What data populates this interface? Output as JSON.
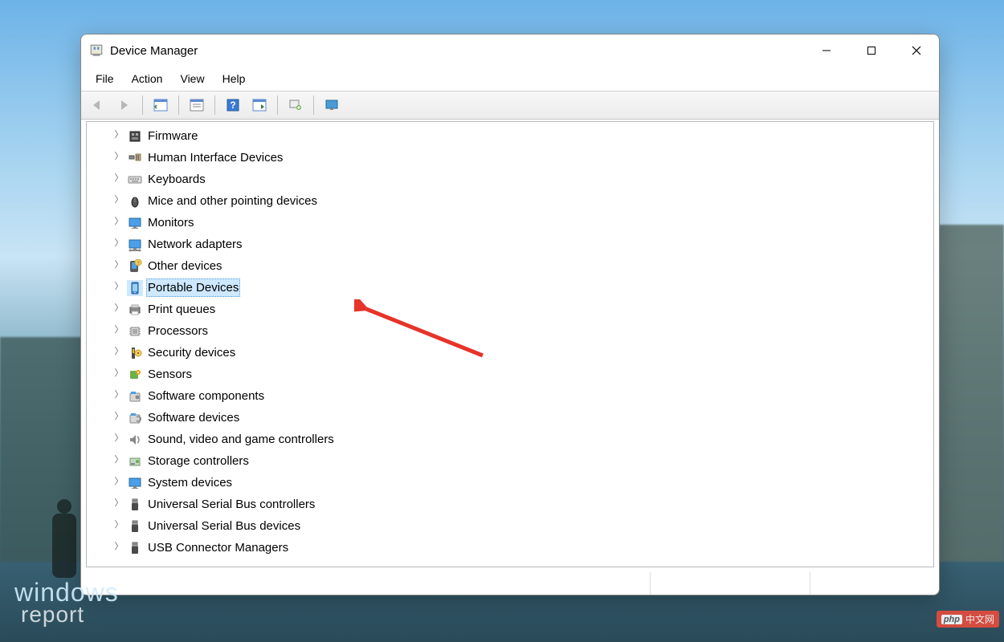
{
  "window": {
    "title": "Device Manager"
  },
  "menu": {
    "items": [
      {
        "label": "File"
      },
      {
        "label": "Action"
      },
      {
        "label": "View"
      },
      {
        "label": "Help"
      }
    ]
  },
  "toolbar": {
    "buttons": [
      {
        "name": "back",
        "enabled": false
      },
      {
        "name": "forward",
        "enabled": false
      },
      {
        "name": "show-hide-tree",
        "enabled": true
      },
      {
        "name": "properties",
        "enabled": true
      },
      {
        "name": "help",
        "enabled": true
      },
      {
        "name": "action-view",
        "enabled": true
      },
      {
        "name": "scan-hardware",
        "enabled": true
      },
      {
        "name": "add-legacy",
        "enabled": true
      }
    ]
  },
  "tree": {
    "items": [
      {
        "icon": "firmware",
        "label": "Firmware",
        "selected": false
      },
      {
        "icon": "hid",
        "label": "Human Interface Devices",
        "selected": false
      },
      {
        "icon": "keyboard",
        "label": "Keyboards",
        "selected": false
      },
      {
        "icon": "mouse",
        "label": "Mice and other pointing devices",
        "selected": false
      },
      {
        "icon": "monitor",
        "label": "Monitors",
        "selected": false
      },
      {
        "icon": "network",
        "label": "Network adapters",
        "selected": false
      },
      {
        "icon": "other",
        "label": "Other devices",
        "selected": false
      },
      {
        "icon": "portable",
        "label": "Portable Devices",
        "selected": true
      },
      {
        "icon": "printer",
        "label": "Print queues",
        "selected": false
      },
      {
        "icon": "cpu",
        "label": "Processors",
        "selected": false
      },
      {
        "icon": "security",
        "label": "Security devices",
        "selected": false
      },
      {
        "icon": "sensor",
        "label": "Sensors",
        "selected": false
      },
      {
        "icon": "swcomp",
        "label": "Software components",
        "selected": false
      },
      {
        "icon": "swdev",
        "label": "Software devices",
        "selected": false
      },
      {
        "icon": "sound",
        "label": "Sound, video and game controllers",
        "selected": false
      },
      {
        "icon": "storage",
        "label": "Storage controllers",
        "selected": false
      },
      {
        "icon": "system",
        "label": "System devices",
        "selected": false
      },
      {
        "icon": "usb",
        "label": "Universal Serial Bus controllers",
        "selected": false
      },
      {
        "icon": "usb",
        "label": "Universal Serial Bus devices",
        "selected": false
      },
      {
        "icon": "usb",
        "label": "USB Connector Managers",
        "selected": false
      }
    ]
  },
  "watermark": {
    "line1": "windows",
    "line2": "report"
  },
  "badge": {
    "text": "中文网"
  }
}
